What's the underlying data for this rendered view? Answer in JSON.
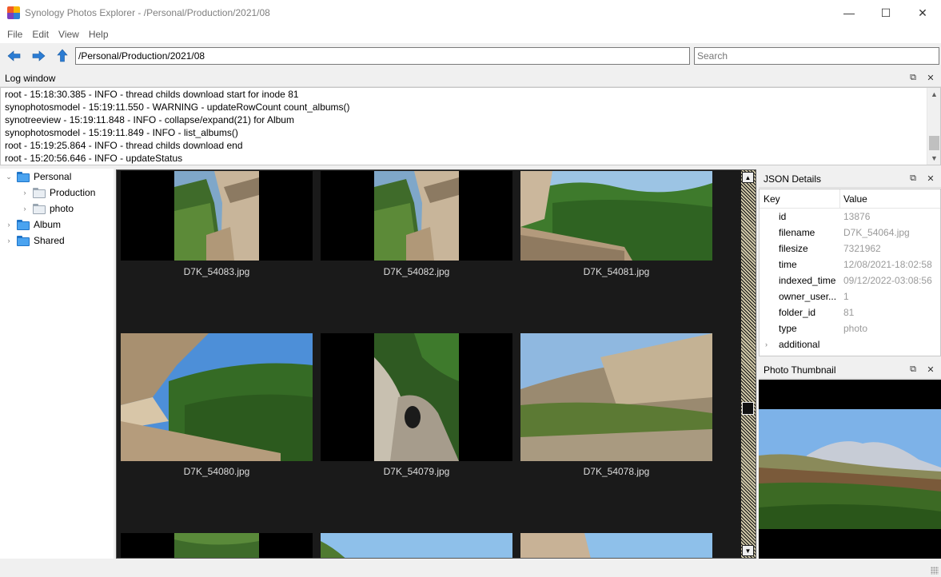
{
  "window": {
    "title": "Synology Photos Explorer - /Personal/Production/2021/08",
    "minimize_glyph": "—",
    "maximize_glyph": "☐",
    "close_glyph": "✕"
  },
  "menu": [
    "File",
    "Edit",
    "View",
    "Help"
  ],
  "toolbar": {
    "path_value": "/Personal/Production/2021/08",
    "search_placeholder": "Search",
    "back_icon": "arrow-left-icon",
    "forward_icon": "arrow-right-icon",
    "up_icon": "arrow-up-icon",
    "accent": "#2b7cd3"
  },
  "log": {
    "title": "Log window",
    "lines": [
      "root - 15:18:30.385 - INFO - thread childs download start for inode 81",
      "synophotosmodel - 15:19:11.550 - WARNING - updateRowCount count_albums()",
      "synotreeview - 15:19:11.848 - INFO - collapse/expand(21) for Album",
      "synophotosmodel - 15:19:11.849 - INFO - list_albums()",
      "root - 15:19:25.864 - INFO - thread childs download end",
      "root - 15:20:56.646 - INFO - updateStatus"
    ]
  },
  "tree": [
    {
      "label": "Personal",
      "expanded": true,
      "level": 0,
      "folder": "blue"
    },
    {
      "label": "Production",
      "expanded": false,
      "level": 1,
      "folder": "gray"
    },
    {
      "label": "photo",
      "expanded": false,
      "level": 1,
      "folder": "gray"
    },
    {
      "label": "Album",
      "expanded": false,
      "level": 0,
      "folder": "blue"
    },
    {
      "label": "Shared",
      "expanded": false,
      "level": 0,
      "folder": "blue"
    }
  ],
  "gallery": {
    "items": [
      {
        "filename": "D7K_54083.jpg",
        "scene": "cliff-portrait"
      },
      {
        "filename": "D7K_54082.jpg",
        "scene": "cliff-portrait"
      },
      {
        "filename": "D7K_54081.jpg",
        "scene": "forest-wall"
      },
      {
        "filename": "D7K_54080.jpg",
        "scene": "overhang"
      },
      {
        "filename": "D7K_54079.jpg",
        "scene": "cave"
      },
      {
        "filename": "D7K_54078.jpg",
        "scene": "rock-face"
      },
      {
        "filename": "",
        "scene": "forest-partial"
      },
      {
        "filename": "",
        "scene": "sky-partial"
      },
      {
        "filename": "",
        "scene": "rock-sky-partial"
      }
    ]
  },
  "json_details": {
    "title": "JSON Details",
    "col_key": "Key",
    "col_value": "Value",
    "rows": [
      {
        "key": "id",
        "value": "13876"
      },
      {
        "key": "filename",
        "value": "D7K_54064.jpg"
      },
      {
        "key": "filesize",
        "value": "7321962"
      },
      {
        "key": "time",
        "value": "12/08/2021-18:02:58"
      },
      {
        "key": "indexed_time",
        "value": "09/12/2022-03:08:56"
      },
      {
        "key": "owner_user...",
        "value": "1"
      },
      {
        "key": "folder_id",
        "value": "81"
      },
      {
        "key": "type",
        "value": "photo"
      },
      {
        "key": "additional",
        "value": "",
        "expandable": true
      }
    ]
  },
  "photo_thumbnail": {
    "title": "Photo Thumbnail"
  },
  "dock_icons": {
    "float": "float-icon",
    "close": "close-icon",
    "float_glyph": "⧉",
    "close_glyph": "✕"
  }
}
